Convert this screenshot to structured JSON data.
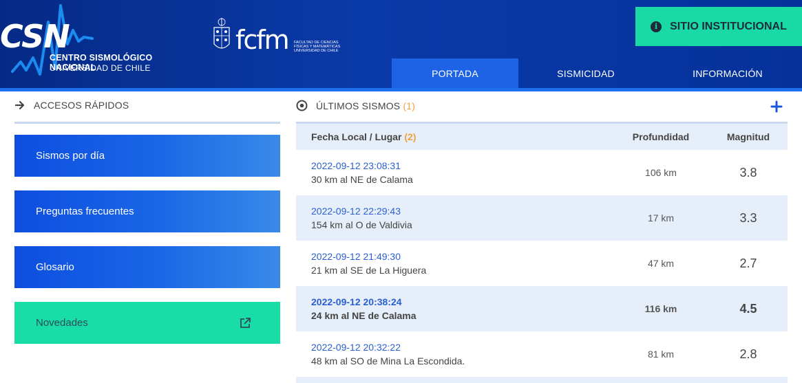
{
  "header": {
    "logo_text": "CSN",
    "logo_name": "CENTRO SISMOLÓGICO NACIONAL",
    "logo_university": "UNIVERSIDAD DE CHILE",
    "fcfm_text": "fcfm",
    "fcfm_sub": [
      "FACULTAD DE CIENCIAS",
      "FÍSICAS Y MATEMÁTICAS",
      "UNIVERSIDAD DE CHILE"
    ],
    "institutional_button": "SITIO INSTITUCIONAL",
    "nav": [
      {
        "label": "PORTADA",
        "active": true
      },
      {
        "label": "SISMICIDAD",
        "active": false
      },
      {
        "label": "INFORMACIÓN",
        "active": false
      }
    ]
  },
  "quick_access": {
    "title": "ACCESOS RÁPIDOS",
    "buttons": [
      "Sismos por día",
      "Preguntas frecuentes",
      "Glosario",
      "Novedades"
    ]
  },
  "latest": {
    "title": "ÚLTIMOS SISMOS",
    "title_note": "(1)",
    "columns": {
      "date_place": "Fecha Local / Lugar",
      "date_place_note": "(2)",
      "depth": "Profundidad",
      "magnitude": "Magnitud"
    },
    "rows": [
      {
        "date": "2022-09-12 23:08:31",
        "place": "30 km al NE de Calama",
        "depth": "106 km",
        "magnitude": "3.8"
      },
      {
        "date": "2022-09-12 22:29:43",
        "place": "154 km al O de Valdivia",
        "depth": "17 km",
        "magnitude": "3.3"
      },
      {
        "date": "2022-09-12 21:49:30",
        "place": "21 km al SE de La Higuera",
        "depth": "47 km",
        "magnitude": "2.7"
      },
      {
        "date": "2022-09-12 20:38:24",
        "place": "24 km al NE de Calama",
        "depth": "116 km",
        "magnitude": "4.5"
      },
      {
        "date": "2022-09-12 20:32:22",
        "place": "48 km al SO de Mina La Escondida.",
        "depth": "81 km",
        "magnitude": "2.8"
      }
    ]
  },
  "colors": {
    "accent": "#1e63e6",
    "green": "#19d9a5",
    "header": "#0a3aa8",
    "note": "#f0a23c"
  }
}
